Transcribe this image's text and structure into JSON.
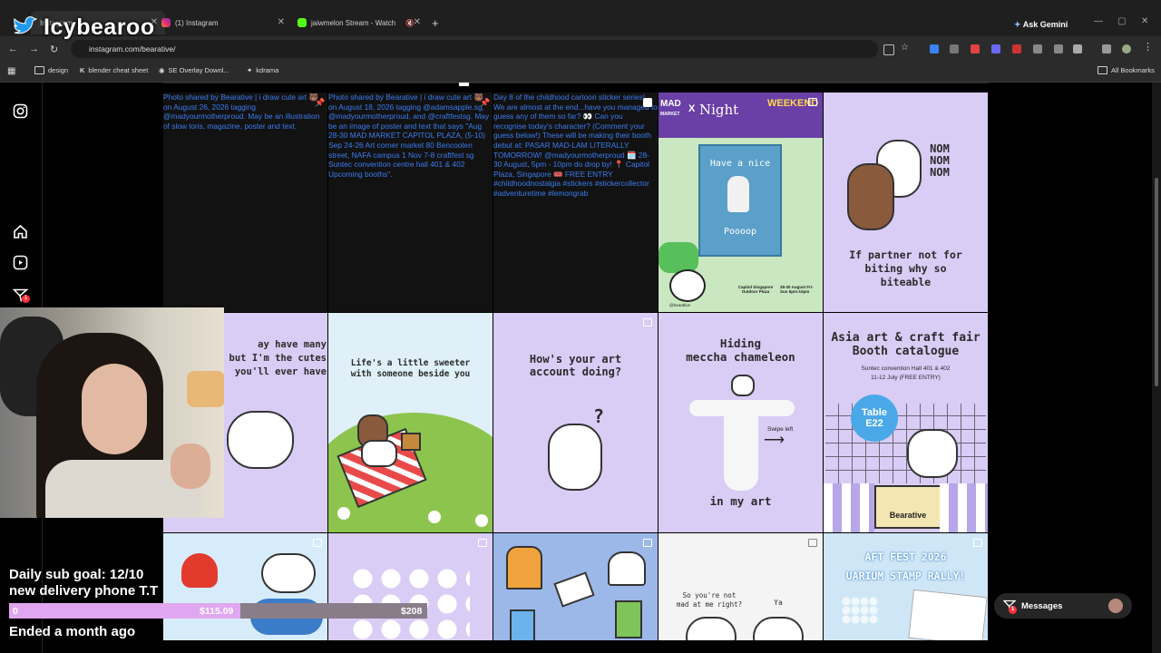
{
  "browser": {
    "tabs": [
      {
        "label": "Instagram",
        "active": true
      },
      {
        "label": "(1) Instagram"
      },
      {
        "label": "jaiwmelon Stream - Watch"
      }
    ],
    "new_tab": "+",
    "ask_gemini": "Ask Gemini",
    "url": "instagram.com/bearative/",
    "bookmarks": [
      "design",
      "blender cheat sheet",
      "SE Overlay Downl...",
      "kdrama"
    ],
    "all_bookmarks": "All Bookmarks"
  },
  "instagram": {
    "posts_alt": [
      "Photo shared by Bearative | i draw cute art 🐻 on August 26, 2026 tagging @madyourmotherproud. May be an illustration of slow loris, magazine, poster and text.",
      "Photo shared by Bearative | i draw cute art 🐻 on August 18, 2026 tagging @adamsapple.sg, @madyourmotherproud, and @craftfestsg. May be an image of poster and text that says \"Aug 28-30 MAD MARKET CAPITOL PLAZA, (5-10) Sep 24-26 Art corner market 80 Bencoolen street, NAFA campus 1 Nov 7-8 craftfest sg Suntec convention centre hall 401 & 402 Upcoming booths\".",
      "Day 8 of the childhood cartoon sticker series! We are almost at the end...have you managed to guess any of them so far? 👀 Can you recognise today's character? (Comment your guess below!) These will be making their booth debut at: PASAR MAD-LAM LITERALLY TOMORROW! @madyourmotherproud 🗓️ 28-30 August, 5pm - 10pm do drop by! 📍 Capitol Plaza, Singapore 🎟️ FREE ENTRY #childhoodnostalgia #stickers #stickercollector #adventuretime #lemongrab"
    ],
    "tiles": {
      "mad_market": {
        "line1": "MAD",
        "line1b": "MARKET",
        "x": "X",
        "night": "Night",
        "weekend": "WEEKEND",
        "nice": "Have a nice",
        "pooop": "Poooop",
        "venue": "Capitol Singapore Outdoor Plaza",
        "dates": "28-30 August Fri-Sun 5pm-10pm",
        "handle": "@bearative"
      },
      "nom": {
        "line1": "NOM",
        "line2": "NOM",
        "line3": "NOM",
        "caption": "If partner not for biting why so biteable"
      },
      "cutest": {
        "line1": "ay have many",
        "line2": "but I'm the cutes",
        "line3": "you'll ever have"
      },
      "sweeter": {
        "caption": "Life's a little sweeter with someone beside you"
      },
      "art_account": {
        "caption": "How's your art account doing?",
        "mark": "?"
      },
      "chameleon": {
        "line1": "Hiding",
        "line2": "meccha chameleon",
        "swipe": "Swipe left",
        "line3": "in my art"
      },
      "catalogue": {
        "title1": "Asia art & craft fair",
        "title2": "Booth catalogue",
        "venue": "Suntec convention Hall 401 & 402",
        "dates": "11-12 July (FREE ENTRY)",
        "table1": "Table",
        "table2": "E22",
        "brand": "Bearative"
      },
      "mad_me": {
        "line1": "So you're not",
        "line2": "mad at me right?",
        "ya": "Ya"
      },
      "stamp": {
        "line1": "AFT FEST 2026",
        "line2": "UARIUM STAMP RALLY!"
      }
    },
    "messages_label": "Messages",
    "messages_badge": "1",
    "notif_badge": "1"
  },
  "stream": {
    "name": "Icybearoo",
    "goal_line1": "Daily sub goal: 12/10",
    "goal_line2": "new delivery phone T.T",
    "bar_start": "0",
    "bar_current": "$115.09",
    "bar_target": "$208",
    "bar_progress": 0.553,
    "ended": "Ended a month ago"
  }
}
